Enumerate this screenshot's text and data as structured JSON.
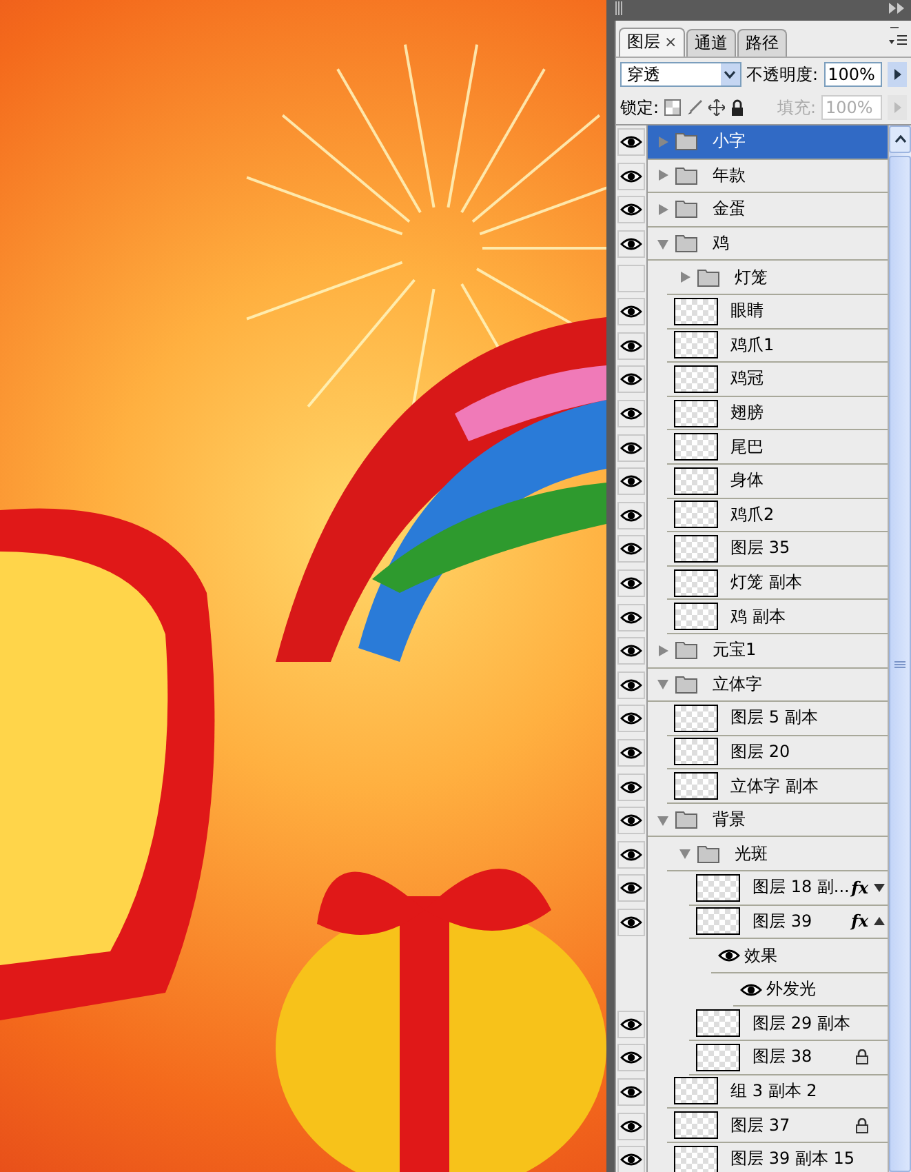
{
  "panel": {
    "tabs": [
      {
        "label": "图层",
        "selected": true,
        "close": "×"
      },
      {
        "label": "通道",
        "selected": false
      },
      {
        "label": "路径",
        "selected": false
      }
    ],
    "blend_mode": {
      "value": "穿透"
    },
    "opacity": {
      "label": "不透明度:",
      "value": "100%"
    },
    "lock": {
      "label": "锁定:"
    },
    "fill": {
      "label": "填充:",
      "value": "100%",
      "disabled": true
    },
    "layers": [
      {
        "kind": "group",
        "name": "小字",
        "visible": true,
        "selected": true,
        "expanded": false
      },
      {
        "kind": "group",
        "name": "年款",
        "visible": true,
        "selected": false,
        "expanded": false
      },
      {
        "kind": "group",
        "name": "金蛋",
        "visible": true,
        "selected": false,
        "expanded": false
      },
      {
        "kind": "group",
        "name": "鸡",
        "visible": true,
        "selected": false,
        "expanded": true,
        "children": [
          {
            "kind": "group",
            "name": "灯笼",
            "visible": false,
            "selected": false,
            "expanded": false
          },
          {
            "kind": "layer",
            "name": "眼睛",
            "visible": true,
            "selected": false
          },
          {
            "kind": "layer",
            "name": "鸡爪1",
            "visible": true,
            "selected": false
          },
          {
            "kind": "layer",
            "name": "鸡冠",
            "visible": true,
            "selected": false
          },
          {
            "kind": "layer",
            "name": "翅膀",
            "visible": true,
            "selected": false
          },
          {
            "kind": "layer",
            "name": "尾巴",
            "visible": true,
            "selected": false
          },
          {
            "kind": "layer",
            "name": "身体",
            "visible": true,
            "selected": false
          },
          {
            "kind": "layer",
            "name": "鸡爪2",
            "visible": true,
            "selected": false
          },
          {
            "kind": "layer",
            "name": "图层 35",
            "visible": true,
            "selected": false
          },
          {
            "kind": "layer",
            "name": "灯笼 副本",
            "visible": true,
            "selected": false
          },
          {
            "kind": "layer",
            "name": "鸡 副本",
            "visible": true,
            "selected": false
          }
        ]
      },
      {
        "kind": "group",
        "name": "元宝1",
        "visible": true,
        "selected": false,
        "expanded": false
      },
      {
        "kind": "group",
        "name": "立体字",
        "visible": true,
        "selected": false,
        "expanded": true,
        "children": [
          {
            "kind": "layer",
            "name": "图层 5 副本",
            "visible": true,
            "selected": false
          },
          {
            "kind": "layer",
            "name": "图层 20",
            "visible": true,
            "selected": false
          },
          {
            "kind": "layer",
            "name": "立体字 副本",
            "visible": true,
            "selected": false
          }
        ]
      },
      {
        "kind": "group",
        "name": "背景",
        "visible": true,
        "selected": false,
        "expanded": true,
        "children": [
          {
            "kind": "group",
            "name": "光斑",
            "visible": true,
            "selected": false,
            "expanded": true,
            "children": [
              {
                "kind": "layer",
                "name": "图层 18 副...",
                "visible": true,
                "selected": false,
                "badge": "fx",
                "expanded": false
              },
              {
                "kind": "layer",
                "name": "图层 39",
                "visible": true,
                "selected": false,
                "badge": "fx",
                "expanded": true,
                "children": [
                  {
                    "kind": "effects",
                    "name": "效果",
                    "visible": true,
                    "children": [
                      {
                        "kind": "effect",
                        "name": "外发光",
                        "visible": true
                      }
                    ]
                  }
                ]
              },
              {
                "kind": "layer",
                "name": "图层 29 副本",
                "visible": true,
                "selected": false
              },
              {
                "kind": "layer",
                "name": "图层 38",
                "visible": true,
                "selected": false,
                "locked": true
              }
            ]
          },
          {
            "kind": "layer",
            "name": "组 3 副本 2",
            "visible": true,
            "selected": false
          },
          {
            "kind": "layer",
            "name": "图层 37",
            "visible": true,
            "selected": false,
            "locked": true
          },
          {
            "kind": "layer",
            "name": "图层 39 副本 15",
            "visible": true,
            "selected": false
          }
        ]
      }
    ]
  }
}
